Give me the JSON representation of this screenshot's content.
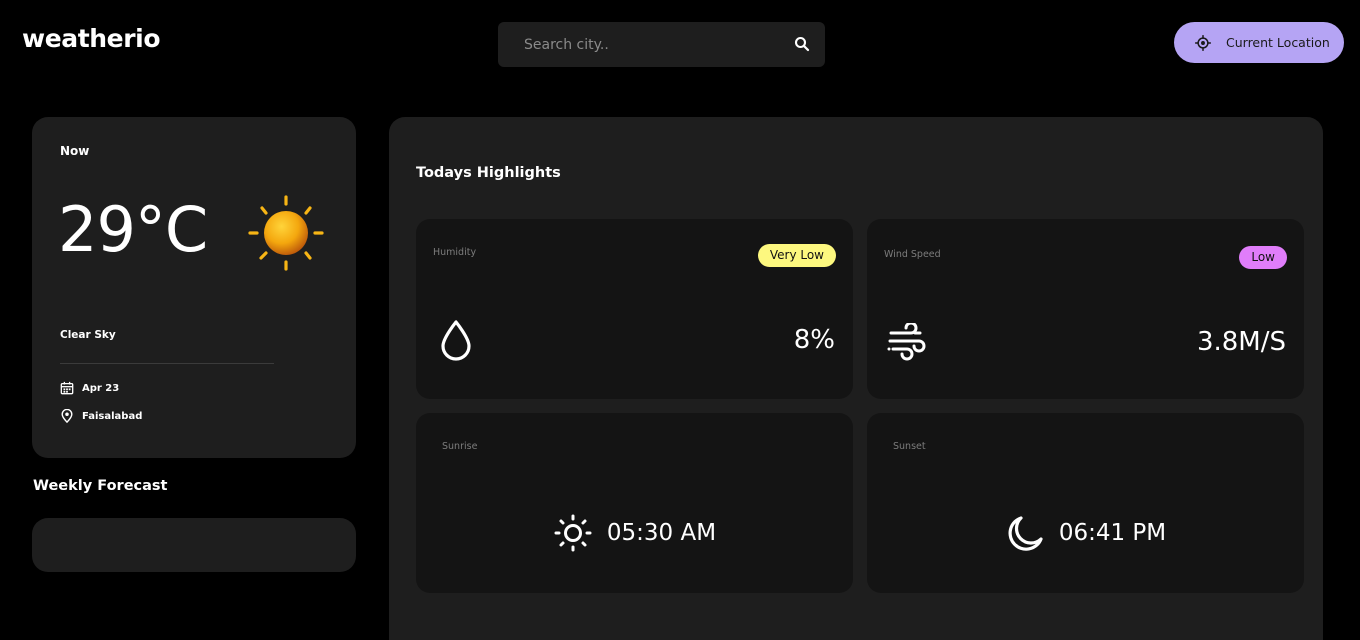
{
  "app": {
    "title": "weatherio"
  },
  "search": {
    "placeholder": "Search city.."
  },
  "location_button": {
    "label": "Current Location"
  },
  "now": {
    "title": "Now",
    "temperature": "29°C",
    "description": "Clear Sky",
    "date": "Apr 23",
    "location": "Faisalabad"
  },
  "weekly": {
    "title": "Weekly Forecast"
  },
  "highlights": {
    "title": "Todays Highlights",
    "humidity": {
      "label": "Humidity",
      "badge": "Very Low",
      "badge_color": "#fdf87f",
      "value": "8%"
    },
    "wind": {
      "label": "Wind Speed",
      "badge": "Low",
      "badge_color": "#e07dfa",
      "value": "3.8M/S"
    },
    "sunrise": {
      "label": "Sunrise",
      "value": "05:30 AM"
    },
    "sunset": {
      "label": "Sunset",
      "value": "06:41 PM"
    }
  },
  "colors": {
    "accent": "#b5a4f4",
    "card": "#1e1e1e",
    "tile": "#141414",
    "background": "#000000"
  },
  "icons": [
    "search-icon",
    "crosshair-icon",
    "sun-icon",
    "calendar-icon",
    "location-pin-icon",
    "water-drop-icon",
    "wind-icon",
    "sunrise-icon",
    "moon-icon"
  ]
}
